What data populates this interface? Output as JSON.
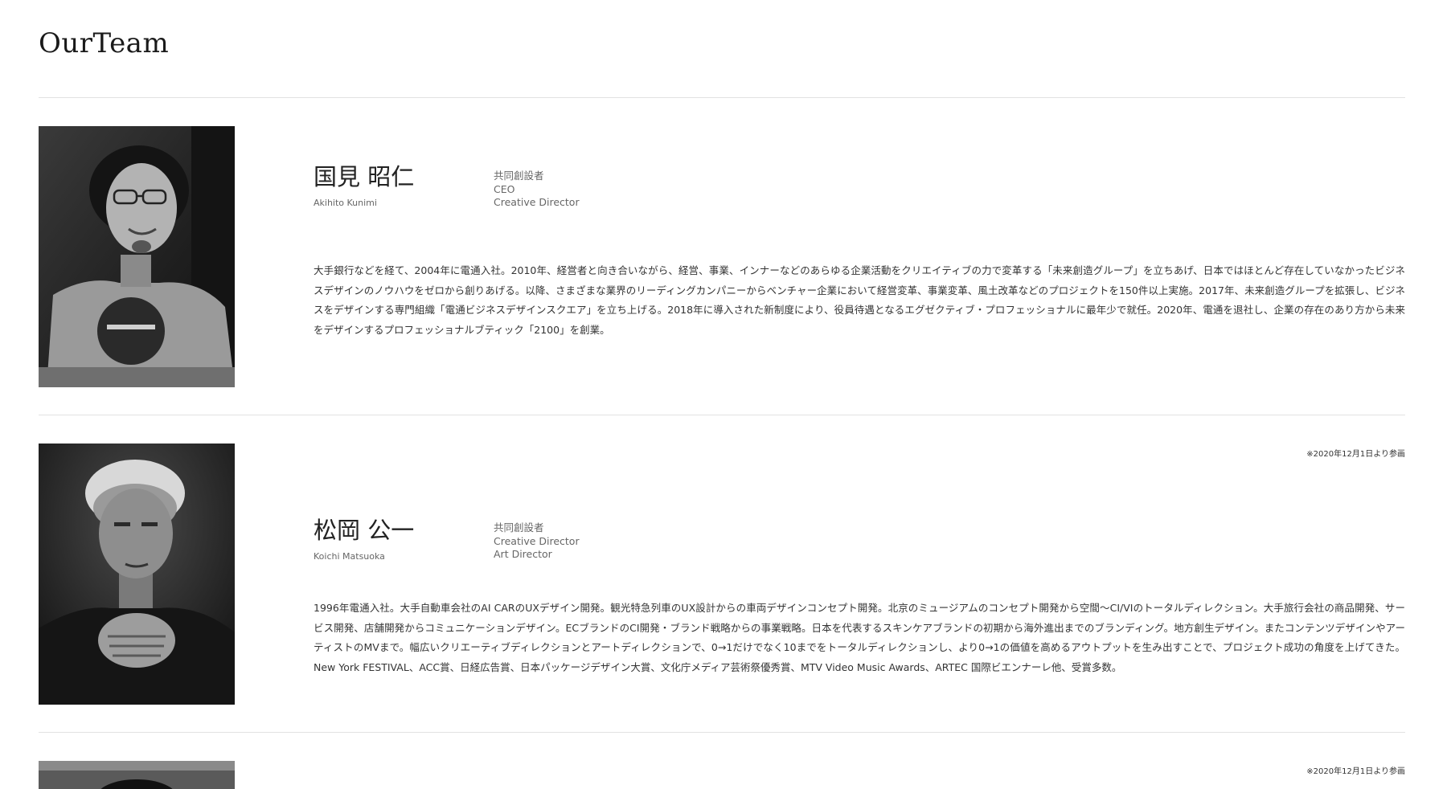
{
  "page": {
    "title": "OurTeam"
  },
  "members": [
    {
      "name_jp": "国見 昭仁",
      "name_en": "Akihito Kunimi",
      "roles": [
        "共同創設者",
        "CEO",
        "Creative Director"
      ],
      "note": "",
      "bio": "大手銀行などを経て、2004年に電通入社。2010年、経営者と向き合いながら、経営、事業、インナーなどのあらゆる企業活動をクリエイティブの力で変革する「未来創造グループ」を立ちあげ、日本ではほとんど存在していなかったビジネスデザインのノウハウをゼロから創りあげる。以降、さまざまな業界のリーディングカンパニーからベンチャー企業において経営変革、事業変革、風土改革などのプロジェクトを150件以上実施。2017年、未来創造グループを拡張し、ビジネスをデザインする専門組織「電通ビジネスデザインスクエア」を立ち上げる。2018年に導入された新制度により、役員待遇となるエグゼクティブ・プロフェッショナルに最年少で就任。2020年、電通を退社し、企業の存在のあり方から未来をデザインするプロフェッショナルブティック「2100」を創業。"
    },
    {
      "name_jp": "松岡 公一",
      "name_en": "Koichi Matsuoka",
      "roles": [
        "共同創設者",
        "Creative Director",
        "Art Director"
      ],
      "note": "※2020年12月1日より参画",
      "bio": "1996年電通入社。大手自動車会社のAI CARのUXデザイン開発。観光特急列車のUX設計からの車両デザインコンセプト開発。北京のミュージアムのコンセプト開発から空間〜CI/VIのトータルディレクション。大手旅行会社の商品開発、サービス開発、店舗開発からコミュニケーションデザイン。ECブランドのCI開発・ブランド戦略からの事業戦略。日本を代表するスキンケアブランドの初期から海外進出までのブランディング。地方創生デザイン。またコンテンツデザインやアーティストのMVまで。幅広いクリエーティブディレクションとアートディレクションで、0→1だけでなく10までをトータルディレクションし、より0→1の価値を高めるアウトプットを生み出すことで、プロジェクト成功の角度を上げてきた。New York FESTIVAL、ACC賞、日経広告賞、日本パッケージデザイン大賞、文化庁メディア芸術祭優秀賞、MTV Video Music Awards、ARTEC 国際ビエンナーレ他、受賞多数。"
    },
    {
      "note": "※2020年12月1日より参画"
    }
  ],
  "icons": {
    "photo": "portrait-photo"
  }
}
